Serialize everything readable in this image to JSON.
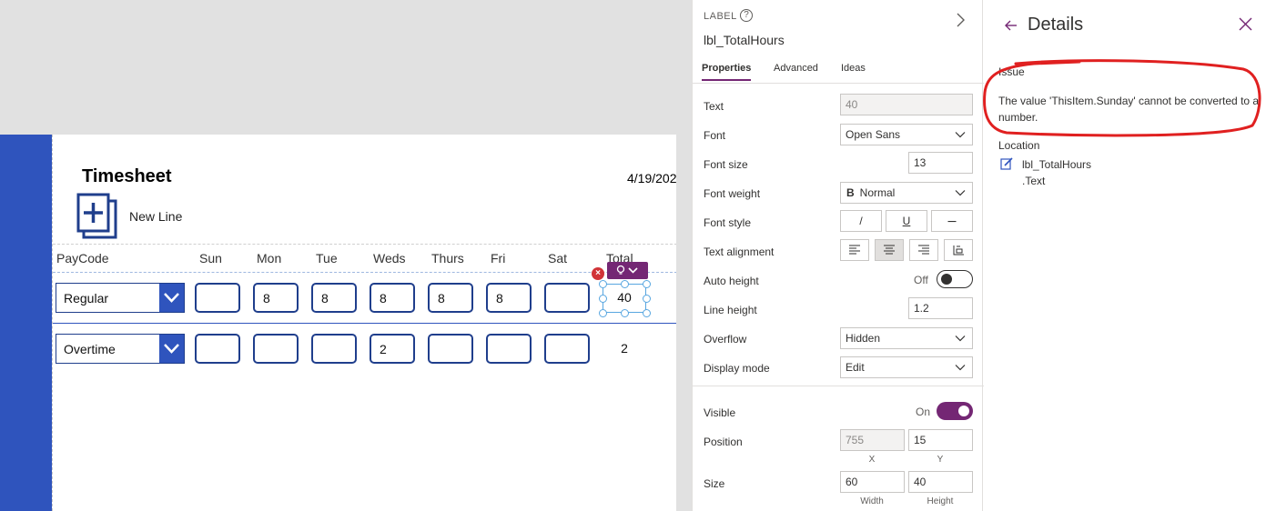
{
  "app": {
    "title": "Timesheet",
    "date": "4/19/202",
    "new_line": "New Line",
    "columns": [
      "PayCode",
      "Sun",
      "Mon",
      "Tue",
      "Weds",
      "Thurs",
      "Fri",
      "Sat",
      "Total"
    ],
    "rows": [
      {
        "paycode": "Regular",
        "days": [
          "",
          "8",
          "8",
          "8",
          "8",
          "8",
          ""
        ],
        "total": "40"
      },
      {
        "paycode": "Overtime",
        "days": [
          "",
          "",
          "",
          "2",
          "",
          "",
          ""
        ],
        "total": "2"
      }
    ],
    "accent_color": "#2f54bd",
    "error_badge": "×"
  },
  "properties": {
    "control_type": "LABEL",
    "control_name": "lbl_TotalHours",
    "tabs": [
      "Properties",
      "Advanced",
      "Ideas"
    ],
    "labels": {
      "text": "Text",
      "font": "Font",
      "font_size": "Font size",
      "font_weight": "Font weight",
      "font_style": "Font style",
      "text_alignment": "Text alignment",
      "auto_height": "Auto height",
      "line_height": "Line height",
      "overflow": "Overflow",
      "display_mode": "Display mode",
      "visible": "Visible",
      "position": "Position",
      "size": "Size"
    },
    "values": {
      "text": "40",
      "font": "Open Sans",
      "font_size": "13",
      "font_weight": "Normal",
      "auto_height": "Off",
      "line_height": "1.2",
      "overflow": "Hidden",
      "display_mode": "Edit",
      "visible": "On",
      "x": "755",
      "y": "15",
      "width": "60",
      "height": "40"
    },
    "sub_labels": {
      "x": "X",
      "y": "Y",
      "width": "Width",
      "height": "Height"
    },
    "font_weight_icon": "B",
    "style_buttons": [
      "/",
      "U",
      "—"
    ],
    "toggle_on_color": "#742774"
  },
  "details": {
    "title": "Details",
    "issue_heading": "Issue",
    "issue_text": "The value 'ThisItem.Sunday' cannot be converted to a number.",
    "location_heading": "Location",
    "location_control": "lbl_TotalHours",
    "location_property": ".Text",
    "annotation_color": "#e02020"
  }
}
